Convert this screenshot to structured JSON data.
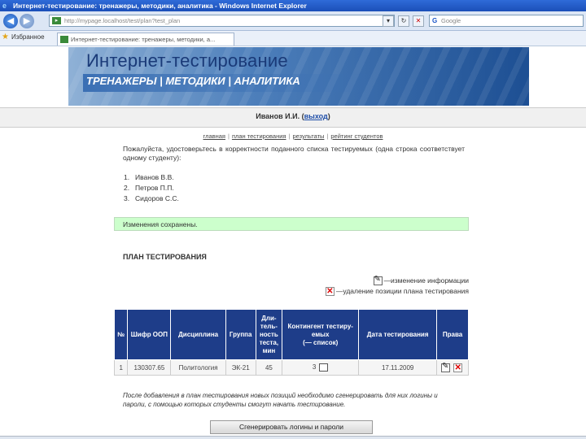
{
  "window": {
    "title": "Интернет-тестирование: тренажеры, методики, аналитика - Windows Internet Explorer"
  },
  "toolbar": {
    "address": "http://mypage.localhost/test/plan?test_plan",
    "search_placeholder": "Google"
  },
  "favorites": {
    "label": "Избранное",
    "tab_title": "Интернет-тестирование: тренажеры, методики, а..."
  },
  "banner": {
    "title": "Интернет-тестирование",
    "subtitle": "ТРЕНАЖЕРЫ | МЕТОДИКИ | АНАЛИТИКА"
  },
  "user": {
    "name": "Иванов И.И.",
    "logout": "выход"
  },
  "menu": [
    "главная",
    "план тестирования",
    "результаты",
    "рейтинг студентов"
  ],
  "confirm_text": "Пожалуйста, удостоверьтесь в корректности поданного списка тестируемых (одна строка соответствует одному студенту):",
  "students": [
    {
      "num": "1.",
      "name": "Иванов В.В."
    },
    {
      "num": "2.",
      "name": "Петров П.П."
    },
    {
      "num": "3.",
      "name": "Сидоров С.С."
    }
  ],
  "saved_msg": "Изменения сохранены.",
  "plan": {
    "title": "ПЛАН ТЕСТИРОВАНИЯ",
    "action_edit": "изменение информации",
    "action_delete": "удаление позиции плана тестирования",
    "headers": {
      "num": "№",
      "code": "Шифр ООП",
      "discipline": "Дисциплина",
      "group": "Группа",
      "duration": "Дли-тель-ность теста, мин",
      "contingent": "Контингент тестиру-емых",
      "contingent_note": "(— список)",
      "date": "Дата тестирования",
      "rights": "Права"
    },
    "rows": [
      {
        "num": "1",
        "code": "130307.65",
        "discipline": "Политология",
        "group": "ЭК-21",
        "duration": "45",
        "contingent": "3",
        "date": "17.11.2009"
      }
    ]
  },
  "note": "После добавления в план тестирования новых позиций необходимо сгенерировать для них логины и пароли, с помощью которых студенты смогут начать тестирование.",
  "generate_button": "Сгенерировать логины и пароли"
}
